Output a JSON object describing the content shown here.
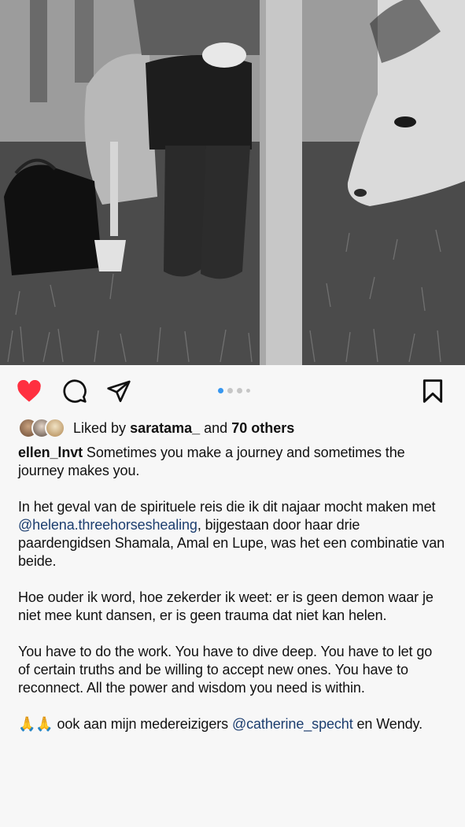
{
  "post": {
    "image_alt": "Person in rubber boots sitting on a chair in a grass field next to a grazing white horse",
    "carousel": {
      "count": 4,
      "active": 0
    }
  },
  "icons": {
    "like": "heart-filled-icon",
    "comment": "comment-icon",
    "share": "paper-plane-icon",
    "save": "bookmark-icon"
  },
  "colors": {
    "like": "#ff3040",
    "link": "#1c3e6f",
    "dot_active": "#3797f0"
  },
  "likes": {
    "prefix": "Liked by ",
    "user": "saratama_",
    "middle": " and ",
    "others": "70 others"
  },
  "caption": {
    "username": "ellen_lnvt",
    "first": " Sometimes you make a journey and sometimes the journey makes you.",
    "p2_a": "In het geval van de spirituele reis die ik dit najaar mocht maken met ",
    "p2_mention": "@helena.threehorseshealing",
    "p2_b": ", bijgestaan door haar drie paardengidsen Shamala, Amal en Lupe, was het een combinatie van beide.",
    "p3": "Hoe ouder ik word, hoe zekerder ik weet: er is geen demon waar je niet mee kunt dansen, er is geen trauma dat niet kan helen.",
    "p4": "You have to do the work. You have to dive deep. You have to let go of certain truths and be willing to accept new ones. You have to reconnect. All the power and wisdom you need is within.",
    "p5_a": "🙏🙏 ook aan mijn medereizigers ",
    "p5_mention": "@catherine_specht",
    "p5_b": " en Wendy."
  }
}
